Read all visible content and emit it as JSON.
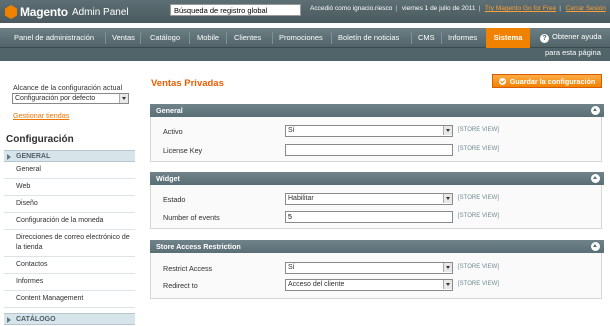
{
  "header": {
    "logo_text": "Magento",
    "logo_sub": "Admin Panel",
    "search_value": "Búsqueda de registro global",
    "logged_in": "Accedió como ignacio.riesco",
    "date": "viernes 1 de julio de 2011",
    "try_link": "Try Magento Go for Free",
    "logout": "Cerrar Sesión"
  },
  "nav": {
    "items": [
      "Panel de administración",
      "Ventas",
      "Catálogo",
      "Mobile",
      "Clientes",
      "Promociones",
      "Boletín de noticias",
      "CMS",
      "Informes",
      "Sistema"
    ],
    "active": "Sistema",
    "help_line1": "Obtener ayuda",
    "help_line2": "para esta página"
  },
  "sidebar": {
    "scope_label": "Alcance de la configuración actual",
    "scope_value": "Configuración por defecto",
    "manage_link": "Gestionar tiendas",
    "config_title": "Configuración",
    "group_general": "GENERAL",
    "items": [
      "General",
      "Web",
      "Diseño",
      "Configuración de la moneda",
      "Direcciones de correo electrónico de la tienda",
      "Contactos",
      "Informes",
      "Content Management"
    ],
    "group_catalog": "CATÁLOGO"
  },
  "main": {
    "title": "Ventas Privadas",
    "save_label": "Guardar la configuración",
    "store_view": "[STORE VIEW]",
    "sections": {
      "general": {
        "title": "General",
        "active_label": "Activo",
        "active_value": "Sí",
        "license_label": "License Key",
        "license_value": ""
      },
      "widget": {
        "title": "Widget",
        "state_label": "Estado",
        "state_value": "Habilitar",
        "events_label": "Number of events",
        "events_value": "5"
      },
      "restriction": {
        "title": "Store Access Restriction",
        "restrict_label": "Restrict Access",
        "restrict_value": "Sí",
        "redirect_label": "Redirect to",
        "redirect_value": "Acceso del cliente"
      }
    }
  }
}
